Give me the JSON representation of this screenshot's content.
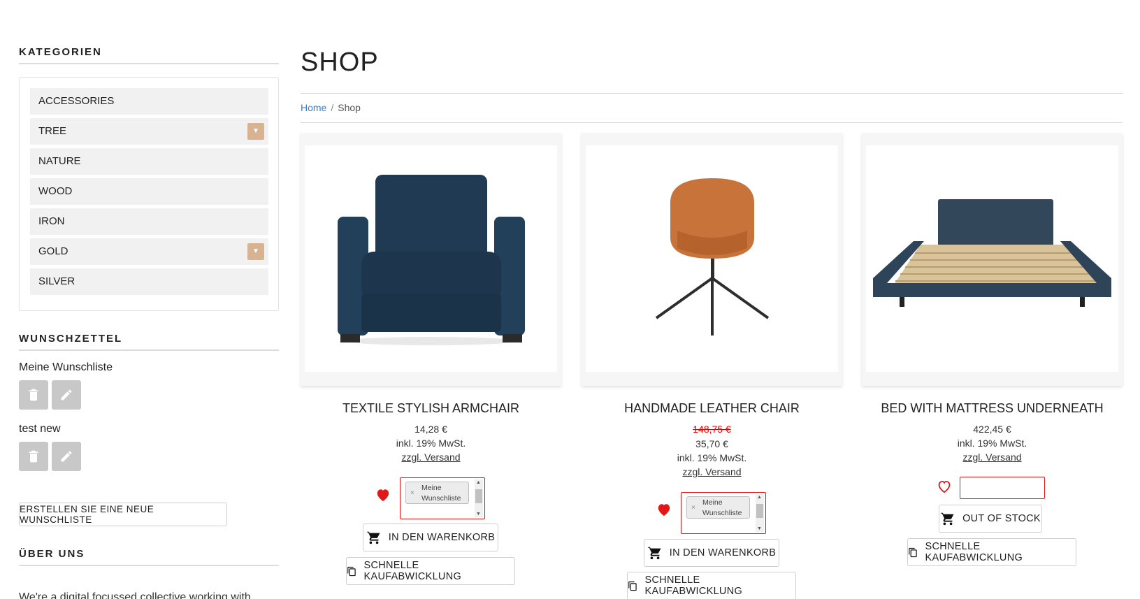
{
  "sidebar": {
    "categories_title": "KATEGORIEN",
    "categories": [
      {
        "label": "ACCESSORIES",
        "has_children": false
      },
      {
        "label": "TREE",
        "has_children": true
      },
      {
        "label": "NATURE",
        "has_children": false
      },
      {
        "label": "WOOD",
        "has_children": false
      },
      {
        "label": "IRON",
        "has_children": false
      },
      {
        "label": "GOLD",
        "has_children": true
      },
      {
        "label": "SILVER",
        "has_children": false
      }
    ],
    "wishlist_title": "WUNSCHZETTEL",
    "wishlists": [
      {
        "name": "Meine Wunschliste"
      },
      {
        "name": "test new"
      }
    ],
    "create_wishlist_label": "ERSTELLEN SIE EINE NEUE WUNSCHLISTE",
    "about_title": "ÜBER UNS",
    "about_text": "We're a digital focussed collective working with"
  },
  "main": {
    "title": "SHOP",
    "breadcrumb": {
      "home": "Home",
      "separator": "/",
      "current": "Shop"
    }
  },
  "products": [
    {
      "title": "TEXTILE STYLISH ARMCHAIR",
      "old_price": "",
      "price": "14,28 €",
      "tax": "inkl. 19% MwSt.",
      "shipping": "zzgl. Versand",
      "wishlist_selected": true,
      "wishlist_tag": "Meine Wunschliste",
      "cart_label": "IN DEN WARENKORB",
      "quick_label": "SCHNELLE KAUFABWICKLUNG"
    },
    {
      "title": "HANDMADE LEATHER CHAIR",
      "old_price": "148,75 €",
      "price": "35,70 €",
      "tax": "inkl. 19% MwSt.",
      "shipping": "zzgl. Versand",
      "wishlist_selected": true,
      "wishlist_tag": "Meine Wunschliste",
      "cart_label": "IN DEN WARENKORB",
      "quick_label": "SCHNELLE KAUFABWICKLUNG"
    },
    {
      "title": "BED WITH MATTRESS UNDERNEATH",
      "old_price": "",
      "price": "422,45 €",
      "tax": "inkl. 19% MwSt.",
      "shipping": "zzgl. Versand",
      "wishlist_selected": false,
      "wishlist_tag": "",
      "cart_label": "OUT OF STOCK",
      "quick_label": "SCHNELLE KAUFABWICKLUNG"
    }
  ],
  "colors": {
    "accent_toggle": "#d8b392",
    "link_blue": "#3f7fc5",
    "wishlist_red": "#e01818",
    "sale_red": "#e00000",
    "icon_button_grey": "#c8c8c8"
  },
  "icons": {
    "toggle": "chevron-down-icon",
    "delete": "trash-icon",
    "edit": "pencil-icon",
    "wishlist": "heart-icon",
    "cart": "shopping-cart-icon",
    "quick_checkout": "copy-icon"
  }
}
